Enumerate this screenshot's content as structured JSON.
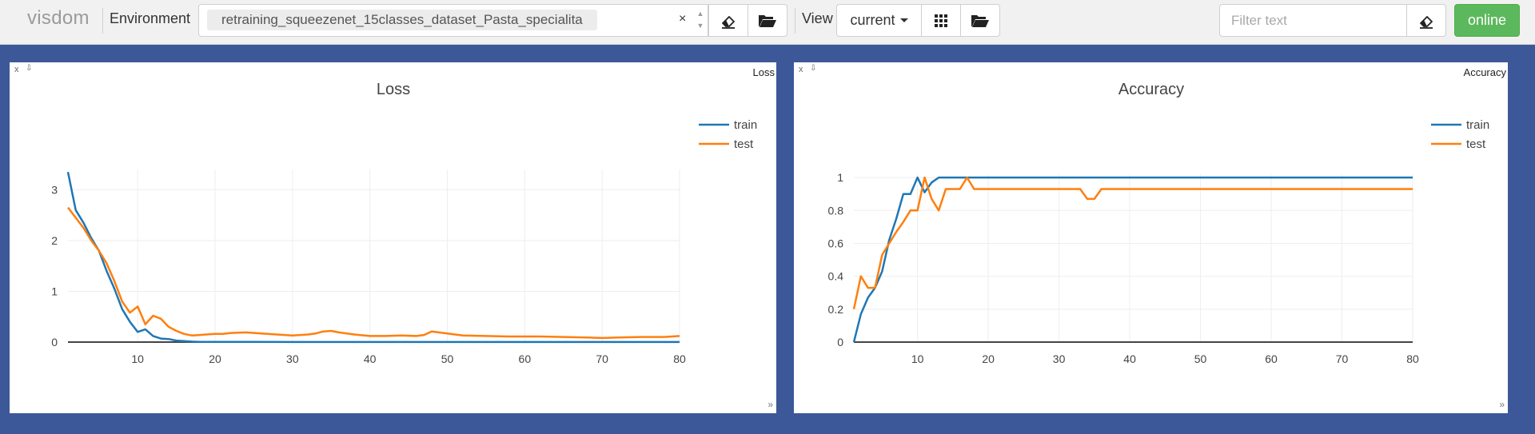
{
  "app": {
    "brand": "visdom"
  },
  "toolbar": {
    "environment_label": "Environment",
    "environment_value": "retraining_squeezenet_15classes_dataset_Pasta_specialita",
    "clear_symbol": "×",
    "view_label": "View",
    "view_value": "current",
    "filter_placeholder": "Filter text",
    "online_label": "online"
  },
  "icons": [
    "eraser-icon",
    "folder-open-icon",
    "grid-icon",
    "chevron-down-icon",
    "close-icon",
    "download-icon",
    "resize-icon"
  ],
  "colors": {
    "background": "#3c5899",
    "train": "#1f77b4",
    "test": "#ff7f0e",
    "online": "#5cb85c"
  },
  "panes": [
    {
      "window_title": "Loss",
      "close": "x",
      "download": "⇩",
      "resize": "»"
    },
    {
      "window_title": "Accuracy",
      "close": "x",
      "download": "⇩",
      "resize": "»"
    }
  ],
  "chart_data": [
    {
      "type": "line",
      "title": "Loss",
      "xlabel": "",
      "ylabel": "",
      "xlim": [
        1,
        80
      ],
      "ylim": [
        0,
        3.4
      ],
      "xticks": [
        10,
        20,
        30,
        40,
        50,
        60,
        70,
        80
      ],
      "yticks": [
        0,
        1,
        2,
        3
      ],
      "grid": true,
      "legend": "top-right",
      "series": [
        {
          "name": "train",
          "color": "#1f77b4",
          "x": [
            1,
            2,
            3,
            4,
            5,
            6,
            7,
            8,
            9,
            10,
            11,
            12,
            13,
            14,
            15,
            16,
            17,
            18,
            20,
            25,
            30,
            40,
            50,
            60,
            70,
            80
          ],
          "y": [
            3.35,
            2.6,
            2.35,
            2.05,
            1.8,
            1.4,
            1.05,
            0.65,
            0.4,
            0.2,
            0.25,
            0.12,
            0.07,
            0.06,
            0.03,
            0.02,
            0.01,
            0.005,
            0.004,
            0.003,
            0.002,
            0.002,
            0.002,
            0.001,
            0.001,
            0.001
          ]
        },
        {
          "name": "test",
          "color": "#ff7f0e",
          "x": [
            1,
            2,
            3,
            4,
            5,
            6,
            7,
            8,
            9,
            10,
            11,
            12,
            13,
            14,
            15,
            16,
            17,
            18,
            20,
            21,
            22,
            24,
            26,
            28,
            30,
            32,
            33,
            34,
            35,
            36,
            38,
            40,
            42,
            44,
            46,
            47,
            48,
            50,
            52,
            55,
            58,
            60,
            62,
            65,
            68,
            70,
            72,
            75,
            78,
            80
          ],
          "y": [
            2.65,
            2.45,
            2.25,
            2.0,
            1.8,
            1.55,
            1.2,
            0.8,
            0.58,
            0.7,
            0.35,
            0.52,
            0.46,
            0.3,
            0.22,
            0.16,
            0.13,
            0.14,
            0.16,
            0.16,
            0.18,
            0.19,
            0.17,
            0.15,
            0.13,
            0.15,
            0.17,
            0.21,
            0.22,
            0.19,
            0.15,
            0.12,
            0.12,
            0.13,
            0.12,
            0.14,
            0.21,
            0.17,
            0.13,
            0.12,
            0.11,
            0.11,
            0.11,
            0.1,
            0.09,
            0.08,
            0.09,
            0.1,
            0.1,
            0.12
          ]
        }
      ]
    },
    {
      "type": "line",
      "title": "Accuracy",
      "xlabel": "",
      "ylabel": "",
      "xlim": [
        1,
        80
      ],
      "ylim": [
        0,
        1.02
      ],
      "xticks": [
        10,
        20,
        30,
        40,
        50,
        60,
        70,
        80
      ],
      "yticks": [
        0,
        0.2,
        0.4,
        0.6,
        0.8,
        1
      ],
      "ytick_labels": [
        "0",
        "0.2",
        "0.4",
        "0.6",
        "0.8",
        "1"
      ],
      "grid": true,
      "legend": "top-right",
      "series": [
        {
          "name": "train",
          "color": "#1f77b4",
          "x": [
            1,
            2,
            3,
            4,
            5,
            6,
            7,
            8,
            9,
            10,
            11,
            12,
            13,
            80
          ],
          "y": [
            0.0,
            0.17,
            0.27,
            0.33,
            0.43,
            0.62,
            0.75,
            0.9,
            0.9,
            1.0,
            0.91,
            0.97,
            1.0,
            1.0
          ]
        },
        {
          "name": "test",
          "color": "#ff7f0e",
          "x": [
            1,
            2,
            3,
            4,
            5,
            6,
            7,
            8,
            9,
            10,
            11,
            12,
            13,
            14,
            15,
            16,
            17,
            18,
            20,
            30,
            33,
            34,
            35,
            36,
            40,
            80
          ],
          "y": [
            0.2,
            0.4,
            0.33,
            0.33,
            0.53,
            0.6,
            0.67,
            0.73,
            0.8,
            0.8,
            1.0,
            0.87,
            0.8,
            0.93,
            0.93,
            0.93,
            1.0,
            0.93,
            0.93,
            0.93,
            0.93,
            0.87,
            0.87,
            0.93,
            0.93,
            0.93
          ]
        }
      ]
    }
  ]
}
